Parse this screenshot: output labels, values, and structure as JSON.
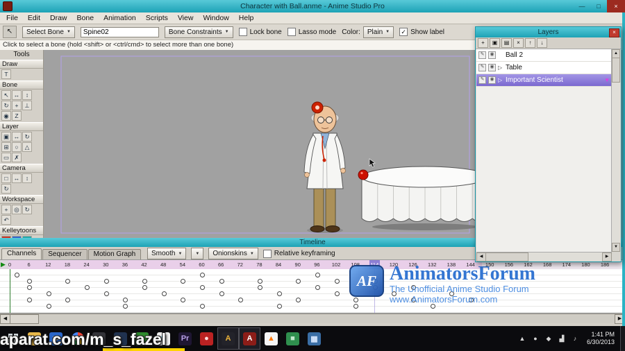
{
  "colors": {
    "accent_teal": "#2bb3c4",
    "selection_purple": "#7a68cf",
    "ruler_pink": "#e9cfe9",
    "frame_highlight": "#8d7fd4",
    "watermark_blue": "#2a6fd0",
    "taskbar_black": "#0b0b0e"
  },
  "icons": {
    "dropdown": "▼",
    "play": "▶",
    "expand": "▷",
    "up": "▲",
    "down": "▼",
    "left": "◀",
    "right": "▶",
    "check": "✓",
    "close": "×",
    "current_tool": "↖"
  },
  "window": {
    "title": "Character with Ball.anme - Anime Studio Pro",
    "controls": [
      {
        "name": "minimize",
        "glyph": "—"
      },
      {
        "name": "maximize",
        "glyph": "□"
      },
      {
        "name": "close",
        "glyph": "×"
      }
    ]
  },
  "menu": {
    "items": [
      "File",
      "Edit",
      "Draw",
      "Bone",
      "Animation",
      "Scripts",
      "View",
      "Window",
      "Help"
    ]
  },
  "toolbar": {
    "select_bone_label": "Select Bone",
    "bone_name_value": "Spine02",
    "bone_constraints_label": "Bone Constraints",
    "lock_bone_label": "Lock bone",
    "lasso_mode_label": "Lasso mode",
    "color_label": "Color:",
    "color_value": "Plain",
    "show_label_label": "Show label",
    "show_label_checked": true
  },
  "hint": "Click to select a bone (hold <shift> or <ctrl/cmd> to select more than one bone)",
  "tools": {
    "title": "Tools",
    "sections": [
      {
        "label": "Draw",
        "icons": [
          {
            "name": "text-tool",
            "glyph": "T"
          }
        ]
      },
      {
        "label": "Bone",
        "icons": [
          {
            "name": "select-bone-tool",
            "glyph": "↖"
          },
          {
            "name": "translate-bone-tool",
            "glyph": "↔"
          },
          {
            "name": "scale-bone-tool",
            "glyph": "↕"
          },
          {
            "name": "rotate-bone-tool",
            "glyph": "↻"
          },
          {
            "name": "add-bone-tool",
            "glyph": "+"
          },
          {
            "name": "reparent-bone-tool",
            "glyph": "⊥"
          },
          {
            "name": "bone-strength-tool",
            "glyph": "◉"
          },
          {
            "name": "offset-bone-tool",
            "glyph": "Z"
          }
        ]
      },
      {
        "label": "Layer",
        "icons": [
          {
            "name": "translate-layer-tool",
            "glyph": "▣"
          },
          {
            "name": "scale-layer-tool",
            "glyph": "↔"
          },
          {
            "name": "rotate-layer-tool",
            "glyph": "↻"
          },
          {
            "name": "shear-layer-tool",
            "glyph": "⊞"
          },
          {
            "name": "follow-path-tool",
            "glyph": "○"
          },
          {
            "name": "rotate-xy-tool",
            "glyph": "△"
          },
          {
            "name": "layer-selector-tool",
            "glyph": "▭"
          },
          {
            "name": "delete-edge-tool",
            "glyph": "✗"
          }
        ]
      },
      {
        "label": "Camera",
        "icons": [
          {
            "name": "track-camera-tool",
            "glyph": "□"
          },
          {
            "name": "pan-tilt-camera-tool",
            "glyph": "↔"
          },
          {
            "name": "roll-camera-tool",
            "glyph": "↕"
          },
          {
            "name": "zoom-camera-tool",
            "glyph": "↻"
          }
        ]
      },
      {
        "label": "Workspace",
        "icons": [
          {
            "name": "pan-workspace-tool",
            "glyph": "+"
          },
          {
            "name": "zoom-workspace-tool",
            "glyph": "◎"
          },
          {
            "name": "rotate-workspace-tool",
            "glyph": "↻"
          },
          {
            "name": "orbit-workspace-tool",
            "glyph": "↶"
          }
        ]
      },
      {
        "label": "Kelleytoons",
        "icons": [
          {
            "name": "kt-script-red",
            "glyph": "",
            "bg": "#cc3322"
          },
          {
            "name": "kt-script-blue",
            "glyph": "",
            "bg": "#3366cc"
          },
          {
            "name": "kt-script-teal",
            "glyph": "",
            "bg": "#22aaaa"
          },
          {
            "name": "kt-script-orange",
            "glyph": "",
            "bg": "#ee8822"
          },
          {
            "name": "kt-green-check",
            "glyph": "✓",
            "bg": "#e8e5de",
            "fg": "#1a9c1a"
          },
          {
            "name": "kt-script-skyblue",
            "glyph": "",
            "bg": "#4488ee"
          },
          {
            "name": "kt-script-yellow",
            "glyph": "",
            "bg": "#eecc22"
          },
          {
            "name": "kt-red-check",
            "glyph": "✓",
            "bg": "#e8e5de",
            "fg": "#cc2222"
          },
          {
            "name": "kt-rainbow",
            "glyph": "",
            "bg": "linear-gradient(45deg,#f00,#ff0,#0f0,#0ff,#00f,#f0f)"
          },
          {
            "name": "kt-camera",
            "glyph": "▣",
            "bg": "#557799",
            "fg": "#fff"
          }
        ]
      }
    ]
  },
  "scene": {
    "background": "#a1a1a1",
    "ball": "#cc1100",
    "coat": "#f6f6f4",
    "pants": "#ab9058",
    "table": "#f4f4f2",
    "skin": "#eec39a"
  },
  "layers_panel": {
    "title": "Layers",
    "toolbar_icons": [
      {
        "name": "new-layer",
        "glyph": "+"
      },
      {
        "name": "new-group",
        "glyph": "▣"
      },
      {
        "name": "duplicate-layer",
        "glyph": "▤"
      },
      {
        "name": "delete-layer",
        "glyph": "×"
      },
      {
        "name": "move-layer-up",
        "glyph": "↑"
      },
      {
        "name": "move-layer-down",
        "glyph": "↓"
      }
    ],
    "rows": [
      {
        "label": "Ball 2",
        "expandable": false,
        "selected": false
      },
      {
        "label": "Table",
        "expandable": true,
        "selected": false
      },
      {
        "label": "Important Scientist",
        "expandable": true,
        "selected": true
      }
    ]
  },
  "timeline": {
    "title": "Timeline",
    "tabs": [
      "Channels",
      "Sequencer",
      "Motion Graph"
    ],
    "active_tab": "Channels",
    "smooth_label": "Smooth",
    "onionskins_label": "Onionskins",
    "relative_keyframing_label": "Relative keyframing",
    "frame_labels": [
      0,
      6,
      12,
      18,
      24,
      30,
      36,
      42,
      48,
      54,
      60,
      66,
      72,
      78,
      84,
      90,
      96,
      102,
      108,
      114,
      120,
      126,
      132,
      138,
      144,
      150,
      156,
      162,
      168,
      174,
      180,
      186
    ],
    "current_frame": 114,
    "start_frame": 0,
    "channel_rows": [
      {
        "keys": [
          2,
          60,
          96
        ]
      },
      {
        "keys": [
          6,
          18,
          30,
          42,
          54,
          66,
          78,
          90,
          102,
          114
        ]
      },
      {
        "keys": [
          6,
          24,
          42,
          60,
          78,
          96,
          114,
          126
        ]
      },
      {
        "keys": [
          12,
          30,
          48,
          66,
          84,
          102,
          120,
          138
        ]
      },
      {
        "keys": [
          6,
          18,
          36,
          54,
          72,
          90,
          108,
          126,
          144
        ]
      },
      {
        "keys": [
          12,
          36,
          60,
          84,
          108,
          132
        ]
      }
    ]
  },
  "watermark": {
    "logo_text": "AF",
    "title": "AnimatorsForum",
    "subtitle": "The Unofficial Anime Studio Forum",
    "url": "www.AnimatorsForum.com"
  },
  "overlay": {
    "text": "aparat.com/m_s_fazel"
  },
  "taskbar": {
    "icons": [
      {
        "name": "start",
        "glyph": ""
      },
      {
        "name": "file-explorer",
        "glyph": "▤",
        "bg": "#e8b84a",
        "fg": "#9a6f1f"
      },
      {
        "name": "media-player",
        "glyph": "▶",
        "bg": "#2a66c8",
        "fg": "#fff"
      },
      {
        "name": "chrome",
        "chrome": true
      },
      {
        "name": "app-dark",
        "glyph": "●",
        "bg": "#333338",
        "fg": "#77bbdd"
      },
      {
        "name": "firefox",
        "glyph": "◗",
        "bg": "#20324f",
        "fg": "#ff9500"
      },
      {
        "name": "app-green",
        "glyph": "●",
        "bg": "#2d8a2d",
        "fg": "#ddffdd"
      },
      {
        "name": "skype",
        "glyph": "S",
        "bg": "#eeeeee",
        "fg": "#0099cc"
      },
      {
        "name": "premiere",
        "glyph": "Pr",
        "bg": "#1e1632",
        "fg": "#b9a0e8"
      },
      {
        "name": "app-red",
        "glyph": "●",
        "bg": "#bb2222",
        "fg": "#ffdddd"
      },
      {
        "name": "audacity",
        "glyph": "A",
        "bg": "#23232a",
        "fg": "#e8b13a",
        "active": true
      },
      {
        "name": "aimp",
        "glyph": "A",
        "bg": "#8c1d18",
        "fg": "#ffffff",
        "active": true
      },
      {
        "name": "vlc",
        "glyph": "▲",
        "bg": "#f5f5f5",
        "fg": "#ff7700"
      },
      {
        "name": "photos",
        "glyph": "■",
        "bg": "#2f8f4e",
        "fg": "#bfe8cc"
      },
      {
        "name": "image-viewer",
        "glyph": "▦",
        "bg": "#3a6ea5",
        "fg": "#d8e8ff"
      }
    ],
    "tray_icons": [
      {
        "name": "tray-expand",
        "glyph": "▲"
      },
      {
        "name": "tray-app-1",
        "glyph": "●"
      },
      {
        "name": "tray-app-2",
        "glyph": "◆"
      },
      {
        "name": "network",
        "glyph": "▟"
      },
      {
        "name": "volume",
        "glyph": "♪"
      }
    ],
    "clock": {
      "time": "1:41 PM",
      "date": "6/30/2013"
    }
  }
}
